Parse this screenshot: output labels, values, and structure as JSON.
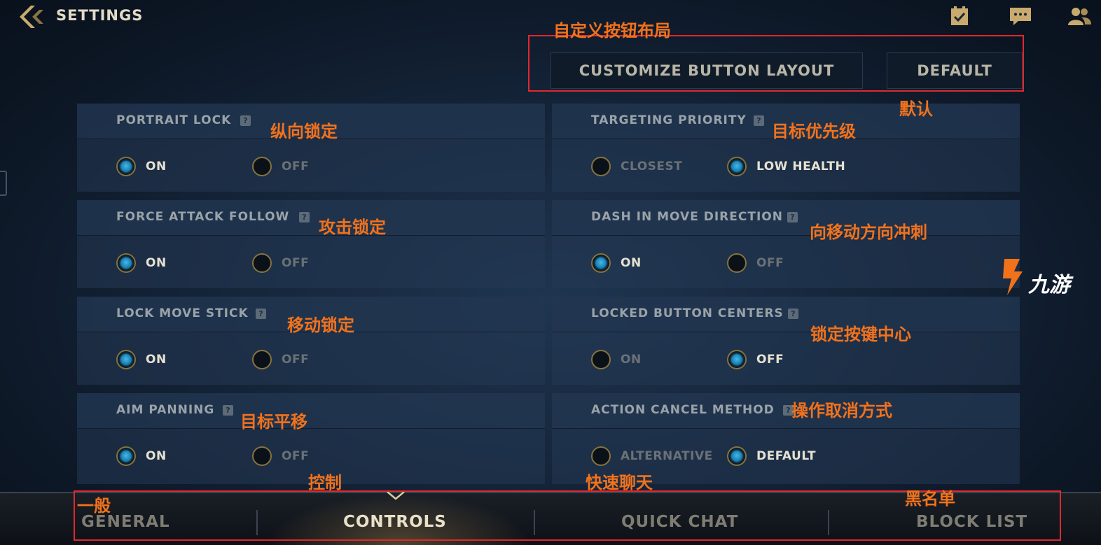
{
  "header": {
    "title": "SETTINGS"
  },
  "buttons": {
    "customize": "CUSTOMIZE BUTTON LAYOUT",
    "default": "DEFAULT"
  },
  "settings": [
    {
      "label": "PORTRAIT LOCK",
      "options": [
        "ON",
        "OFF"
      ],
      "selected": "ON"
    },
    {
      "label": "TARGETING PRIORITY",
      "options": [
        "CLOSEST",
        "LOW HEALTH"
      ],
      "selected": "LOW HEALTH"
    },
    {
      "label": "FORCE ATTACK FOLLOW",
      "options": [
        "ON",
        "OFF"
      ],
      "selected": "ON"
    },
    {
      "label": "DASH IN MOVE DIRECTION",
      "options": [
        "ON",
        "OFF"
      ],
      "selected": "ON"
    },
    {
      "label": "LOCK MOVE STICK",
      "options": [
        "ON",
        "OFF"
      ],
      "selected": "ON"
    },
    {
      "label": "LOCKED BUTTON CENTERS",
      "options": [
        "ON",
        "OFF"
      ],
      "selected": "OFF"
    },
    {
      "label": "AIM PANNING",
      "options": [
        "ON",
        "OFF"
      ],
      "selected": "ON"
    },
    {
      "label": "ACTION CANCEL METHOD",
      "options": [
        "ALTERNATIVE",
        "DEFAULT"
      ],
      "selected": "DEFAULT"
    }
  ],
  "tabs": [
    {
      "label": "GENERAL",
      "active": false
    },
    {
      "label": "CONTROLS",
      "active": true
    },
    {
      "label": "QUICK CHAT",
      "active": false
    },
    {
      "label": "BLOCK LIST",
      "active": false
    }
  ],
  "annotations": {
    "customize": "自定义按钮布局",
    "default": "默认",
    "portrait_lock": "纵向锁定",
    "targeting_priority": "目标优先级",
    "force_attack": "攻击锁定",
    "dash": "向移动方向冲刺",
    "lock_move": "移动锁定",
    "locked_centers": "锁定按键中心",
    "aim_panning": "目标平移",
    "action_cancel": "操作取消方式",
    "general": "一般",
    "controls": "控制",
    "quick_chat": "快速聊天",
    "block_list": "黑名单"
  },
  "watermark": {
    "text": "九游"
  },
  "colors": {
    "accent": "#f2721c",
    "highlight_box": "#e0282e",
    "selected_radio": "#2da0d8",
    "gold": "#c8aa6e"
  },
  "icons": [
    "back-chevron-icon",
    "checklist-icon",
    "chat-icon",
    "friends-icon",
    "help-icon"
  ]
}
